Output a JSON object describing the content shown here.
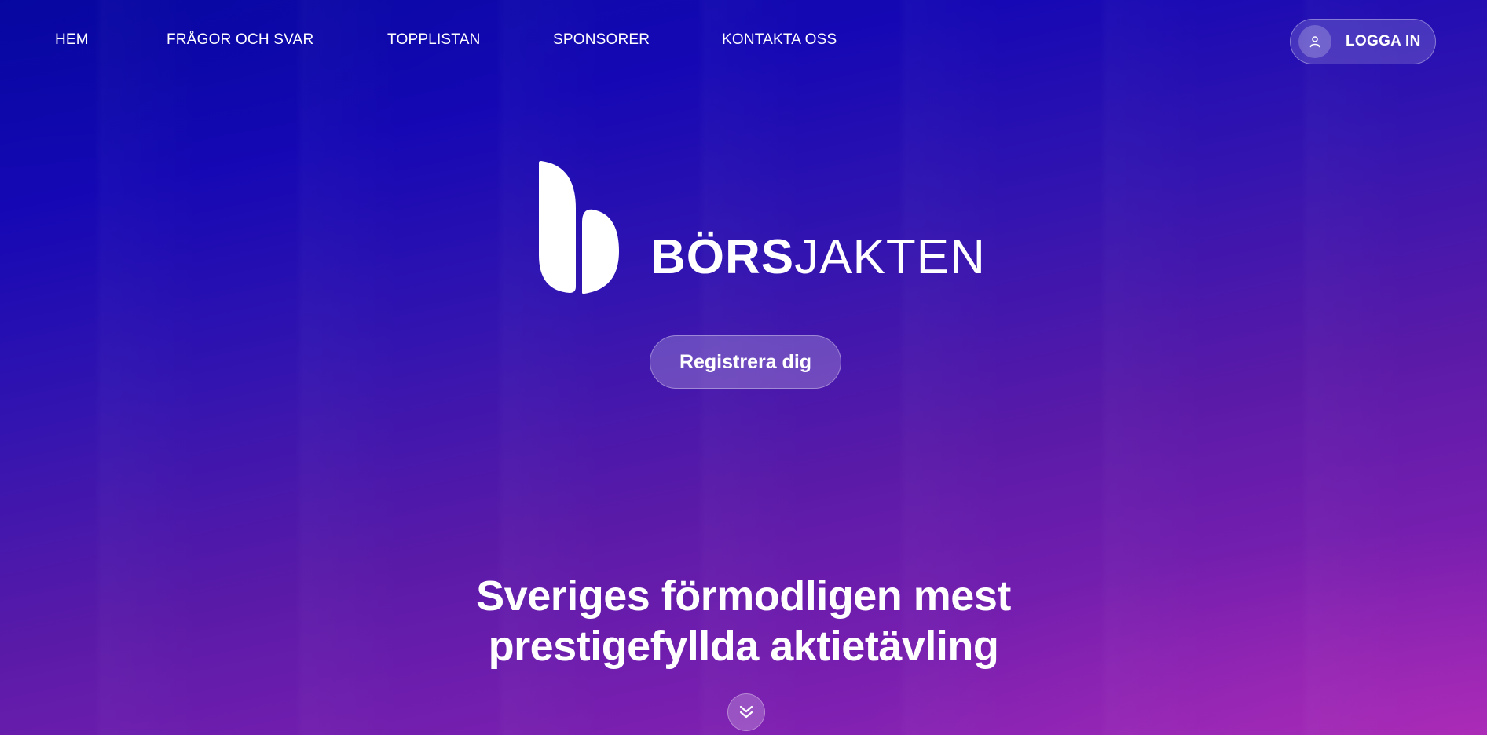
{
  "nav": {
    "links": [
      {
        "label": "HEM"
      },
      {
        "label": "FRÅGOR OCH SVAR"
      },
      {
        "label": "TOPPLISTAN"
      },
      {
        "label": "SPONSORER"
      },
      {
        "label": "KONTAKTA OSS"
      }
    ],
    "login_label": "LOGGA IN",
    "login_icon": "user-icon"
  },
  "logo": {
    "word_bold": "BÖRS",
    "word_thin": "JAKTEN"
  },
  "hero": {
    "register_label": "Registrera dig",
    "headline_line1": "Sveriges förmodligen mest",
    "headline_line2": "prestigefyllda aktietävling",
    "scroll_icon": "double-chevron-down-icon"
  },
  "colors": {
    "gradient_top": "#0a0aa6",
    "gradient_bottom": "#9a27b8",
    "text": "#ffffff"
  }
}
